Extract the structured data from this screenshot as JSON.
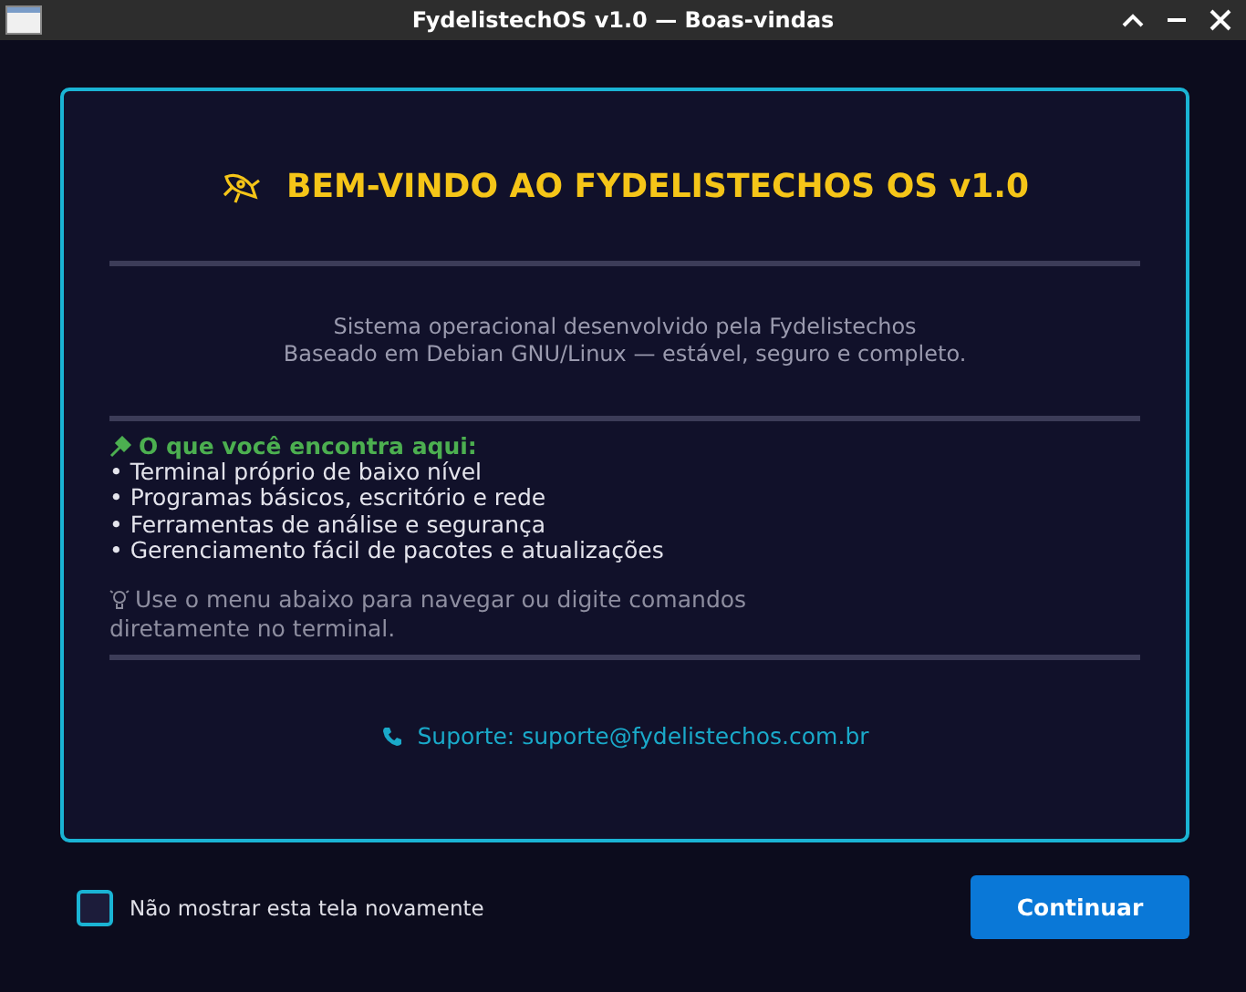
{
  "window": {
    "title": "FydelistechOS v1.0 — Boas-vindas"
  },
  "welcome": {
    "title": "BEM-VINDO AO FYDELISTECHOS OS v1.0",
    "description": [
      "Sistema operacional desenvolvido pela Fydelistechos",
      "Baseado em Debian GNU/Linux — estável, seguro e completo."
    ],
    "features_heading": "O que você encontra aqui:",
    "features": [
      "• Terminal próprio de baixo nível",
      "• Programas básicos, escritório e rede",
      "• Ferramentas de análise e segurança",
      "• Gerenciamento fácil de pacotes e atualizações"
    ],
    "tip": [
      "Use o menu abaixo para navegar ou digite comandos",
      "diretamente no terminal."
    ],
    "support": "Suporte: suporte@fydelistechos.com.br"
  },
  "dont_show_again": {
    "label": "Não mostrar esta tela novamente",
    "checked": false
  },
  "buttons": [
    "Continuar"
  ]
}
